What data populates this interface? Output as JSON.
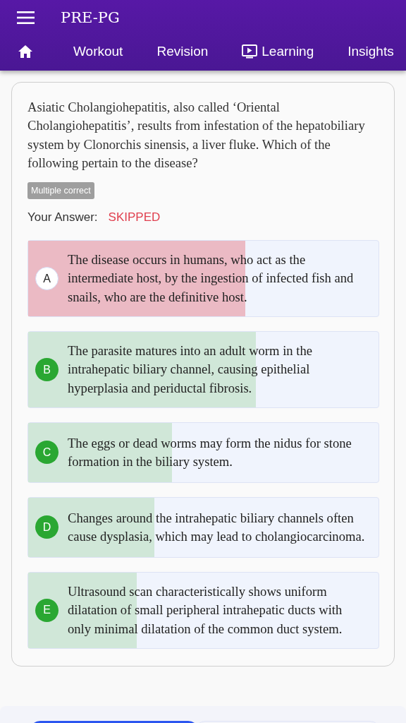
{
  "app_bar": {
    "title": "PRE-PG"
  },
  "tabs": [
    {
      "kind": "home",
      "selected": false
    },
    {
      "kind": "text",
      "label": "Workout",
      "selected": false
    },
    {
      "kind": "text",
      "label": "Revision",
      "selected": false
    },
    {
      "kind": "video",
      "label": "Learning",
      "selected": false
    },
    {
      "kind": "text",
      "label": "Insights",
      "selected": false
    }
  ],
  "question": {
    "text": "Asiatic Cholangiohepatitis, also called ‘Oriental Cholangiohepatitis’, results from infestation of the hepatobiliary system by Clonorchis sinensis, a liver fluke. Which of the following pertain to the disease?",
    "type_badge": "Multiple correct",
    "answer_label": "Your Answer:",
    "answer_value": "SKIPPED"
  },
  "options": [
    {
      "letter": "A",
      "text": "The disease occurs in humans, who act as the intermediate host, by the ingestion of infected fish and snails, who are the definitive host.",
      "correct": false,
      "level": 0.62
    },
    {
      "letter": "B",
      "text": "The parasite matures into an adult worm in the intrahepatic biliary channel, causing epithelial hyperplasia and periductal fibrosis.",
      "correct": true,
      "level": 0.65
    },
    {
      "letter": "C",
      "text": "The eggs or dead worms may form the nidus for stone formation in the biliary system.",
      "correct": true,
      "level": 0.41
    },
    {
      "letter": "D",
      "text": "Changes around the intrahepatic biliary channels often cause dysplasia, which may lead to cholangiocarcinoma.",
      "correct": true,
      "level": 0.36
    },
    {
      "letter": "E",
      "text": "Ultrasound scan characteristically shows uniform dilatation of small peripheral intrahepatic ducts with only minimal dilatation of the common duct system.",
      "correct": true,
      "level": 0.31
    }
  ]
}
